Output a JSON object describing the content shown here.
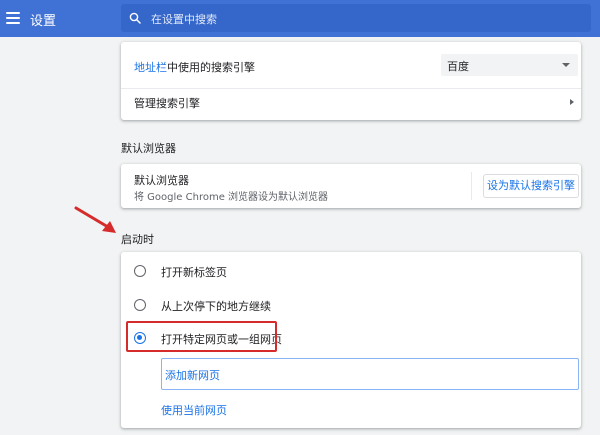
{
  "header": {
    "app_title": "设置",
    "search_placeholder": "在设置中搜索",
    "menu_icon": "hamburger-menu-icon",
    "search_icon": "search-icon"
  },
  "search_engine": {
    "address_bar_label": "地址栏中使用的搜索引擎",
    "address_bar_link_part": "地址栏",
    "address_bar_rest": "中使用的搜索引擎",
    "selected_engine": "百度",
    "manage_label": "管理搜索引擎"
  },
  "default_browser": {
    "section_title": "默认浏览器",
    "row_title": "默认浏览器",
    "row_subtitle": "将 Google Chrome 浏览器设为默认浏览器",
    "button_label": "设为默认搜索引擎"
  },
  "on_startup": {
    "section_title": "启动时",
    "options": [
      {
        "label": "打开新标签页",
        "checked": false
      },
      {
        "label": "从上次停下的地方继续",
        "checked": false
      },
      {
        "label": "打开特定网页或一组网页",
        "checked": true
      }
    ],
    "add_page_label": "添加新网页",
    "use_current_label": "使用当前网页"
  },
  "colors": {
    "header_bg": "#4072d6",
    "accent": "#1a73e8",
    "highlight_red": "#d62b2b",
    "page_bg": "#f1f3f4"
  }
}
